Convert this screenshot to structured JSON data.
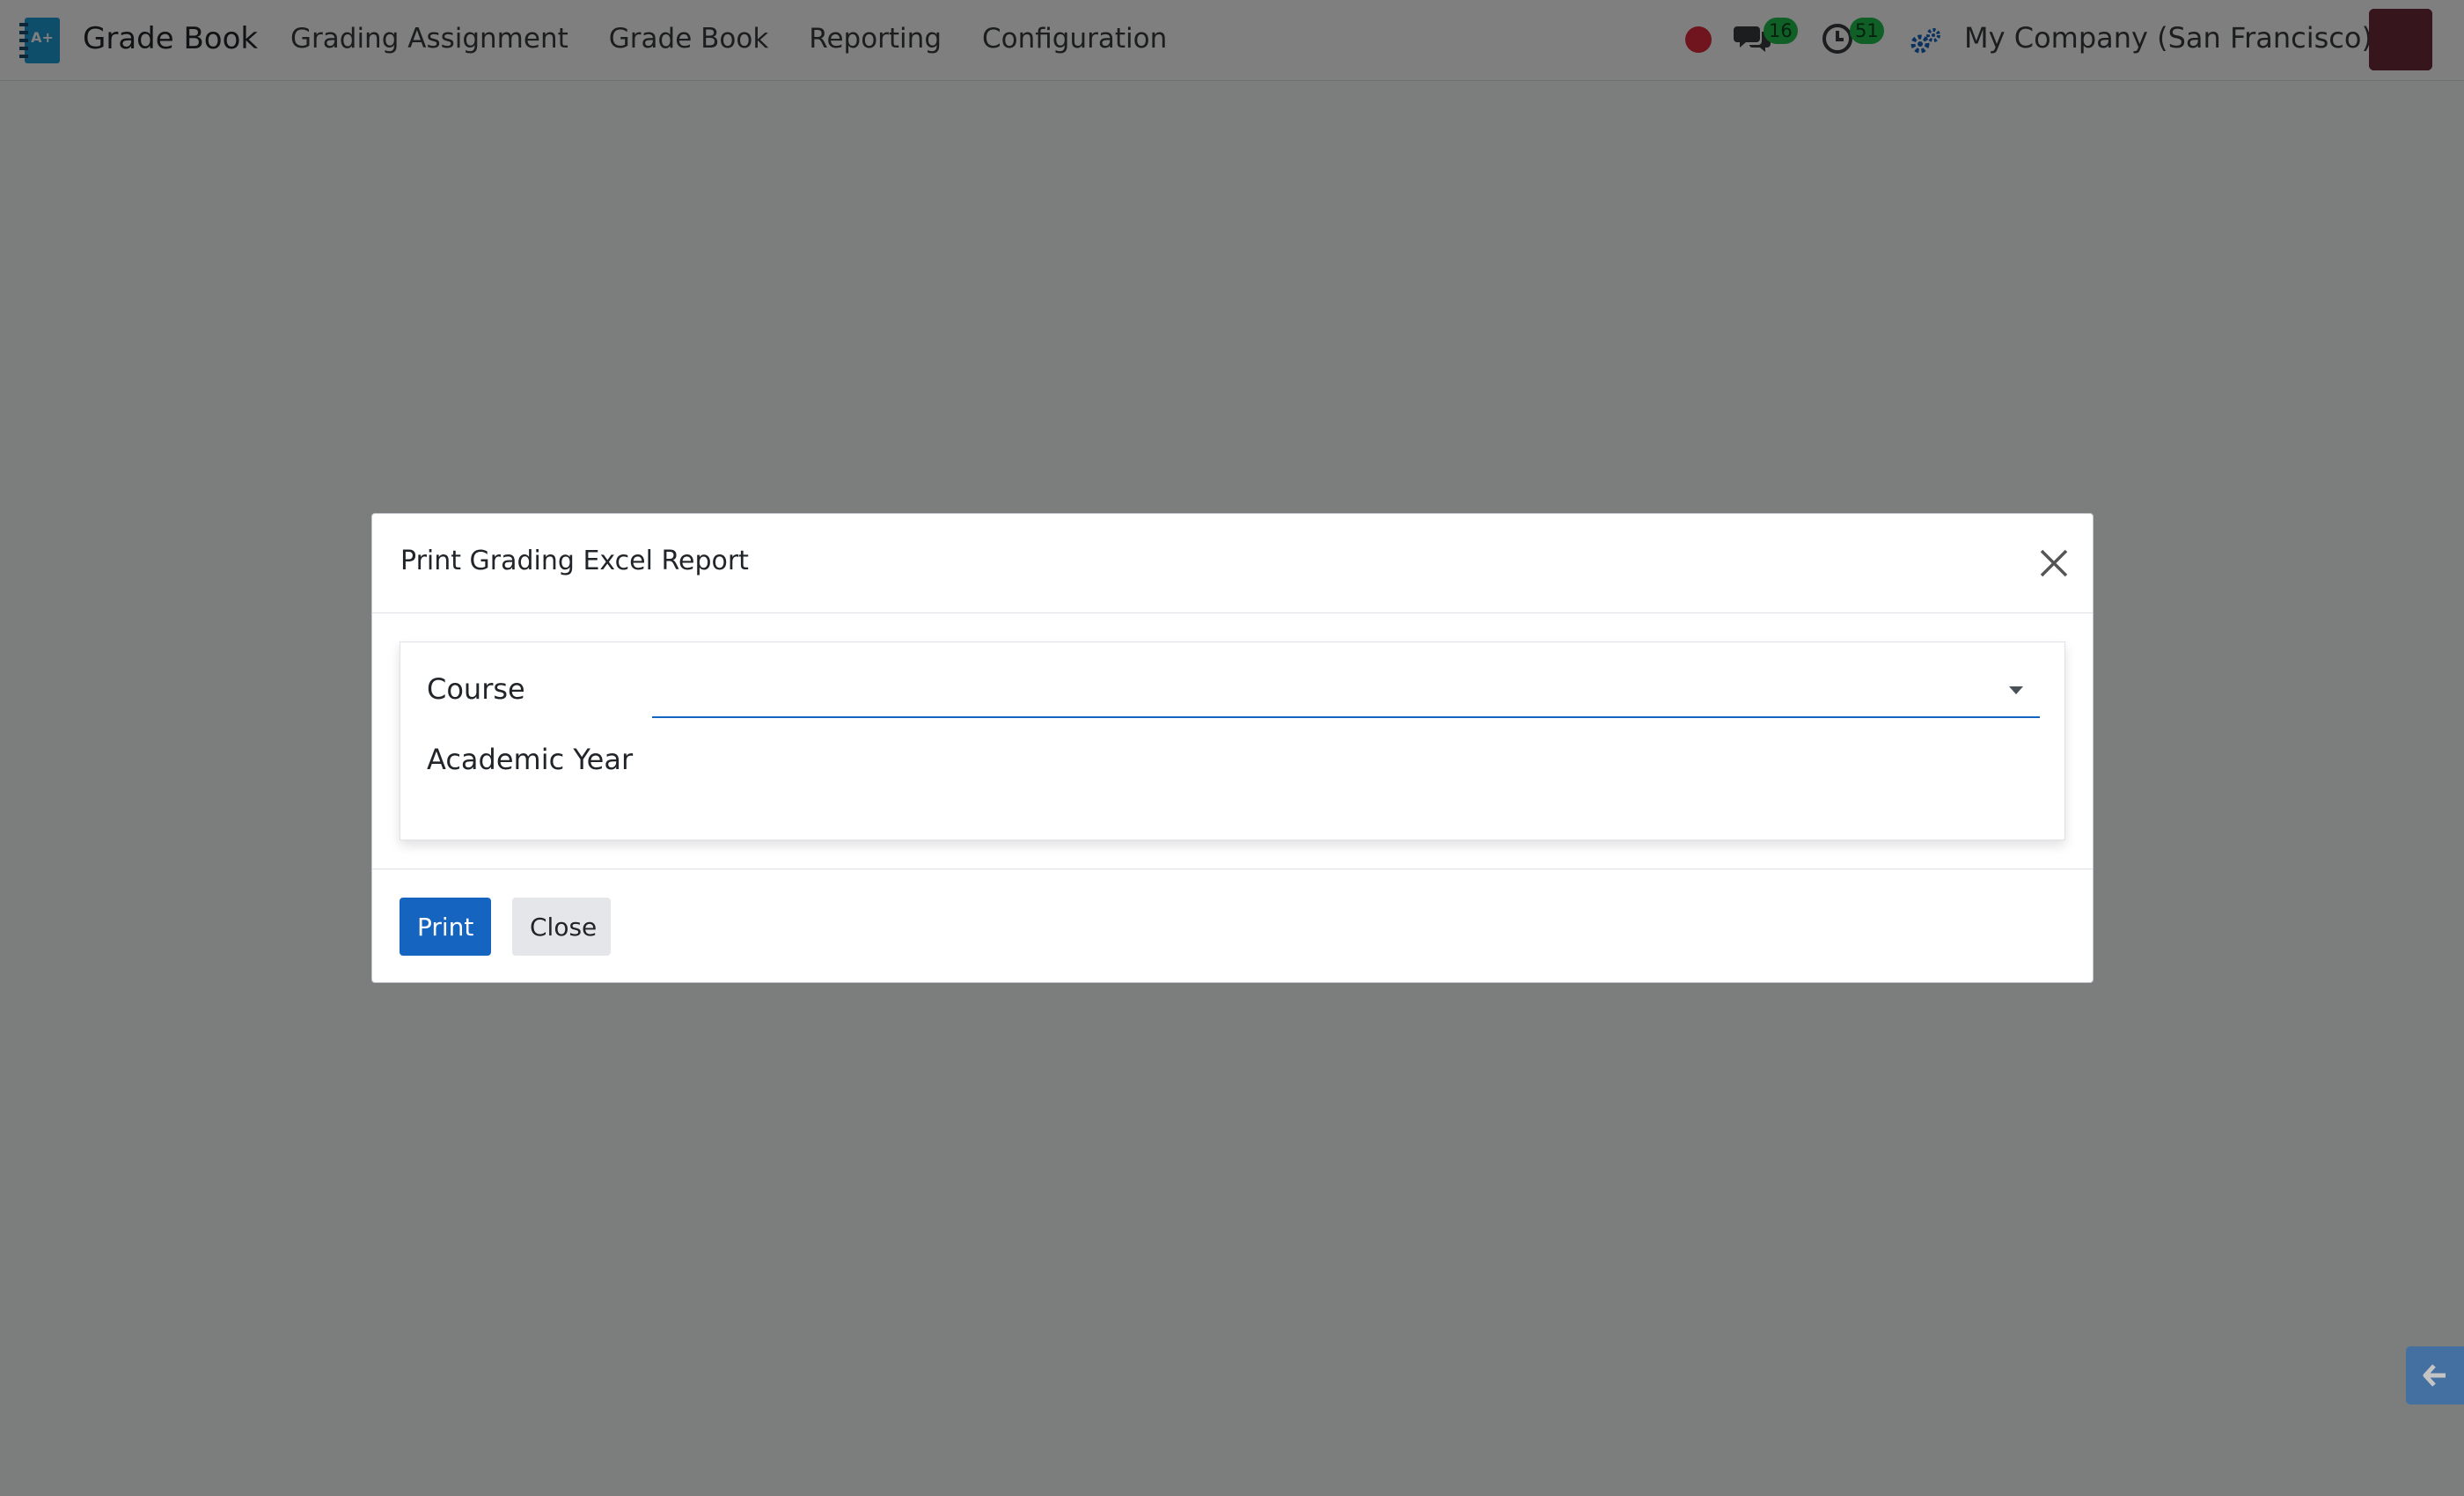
{
  "navbar": {
    "brand": "Grade Book",
    "menu": [
      {
        "label": "Grading Assignment"
      },
      {
        "label": "Grade Book"
      },
      {
        "label": "Reporting"
      },
      {
        "label": "Configuration"
      }
    ],
    "messages_count": "16",
    "activities_count": "51",
    "company": "My Company (San Francisco)",
    "icons": {
      "apps": "grade-book-app-icon",
      "recording": "record-dot-icon",
      "messages": "chat-bubbles-icon",
      "activities": "clock-icon",
      "company_switch": "gears-icon",
      "avatar": "user-avatar"
    }
  },
  "dialog": {
    "title": "Print Grading Excel Report",
    "fields": {
      "course_label": "Course",
      "course_value": "",
      "academic_year_label": "Academic Year"
    },
    "print_label": "Print",
    "close_label": "Close"
  },
  "colors": {
    "primary": "#1565c0",
    "badge": "#1fbf4f",
    "record": "#e0293b"
  }
}
